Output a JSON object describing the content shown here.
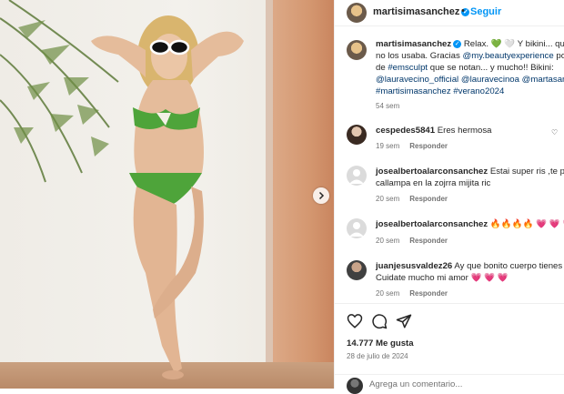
{
  "post": {
    "username": "martisimasanchez",
    "follow_label": "Seguir",
    "caption_lines": [
      {
        "text": "Relax. 💚 🤍 Y bikini... que",
        "type": "normal"
      },
      {
        "text": "no los usaba. Gracias ",
        "link": "@my.beautyexperience",
        "tail": " por"
      },
      {
        "text": "de ",
        "link": "#emsculpt",
        "tail": " que se notan... y mucho!! Bikini:"
      },
      {
        "text": "",
        "link": "@lauravecino_official @lauravecinoa @martasan",
        "tail": ""
      },
      {
        "text": "",
        "link": "#martisimasanchez #verano2024",
        "tail": ""
      }
    ],
    "caption_time": "54 sem"
  },
  "comments": [
    {
      "username": "cespedes5841",
      "text": "Eres hermosa",
      "extra": "",
      "time": "19 sem",
      "reply": "Responder"
    },
    {
      "username": "josealbertoalarconsanchez",
      "text": "Estai super ris ,te por",
      "extra": "callampa en la zojrra mijita ric",
      "time": "20 sem",
      "reply": "Responder"
    },
    {
      "username": "josealbertoalarconsanchez",
      "text": "🔥🔥🔥🔥 💗 💗 💗",
      "extra": "",
      "time": "20 sem",
      "reply": "Responder"
    },
    {
      "username": "juanjesusvaldez26",
      "text": "Ay que bonito cuerpo tienes D",
      "extra": "Cuidate mucho mi amor 💗 💗 💗",
      "time": "20 sem",
      "reply": "Responder"
    }
  ],
  "stats": {
    "likes": "14.777 Me gusta",
    "date": "28 de julio de 2024"
  },
  "comment_input": {
    "placeholder": "Agrega un comentario..."
  },
  "icons": {
    "like": "heart-icon",
    "comment": "comment-icon",
    "share": "share-icon",
    "next": "chevron-right-icon",
    "more": "more-options-icon"
  },
  "colors": {
    "link": "#00376b",
    "follow": "#0095f6",
    "verified": "#0095f6",
    "muted": "#737373"
  }
}
